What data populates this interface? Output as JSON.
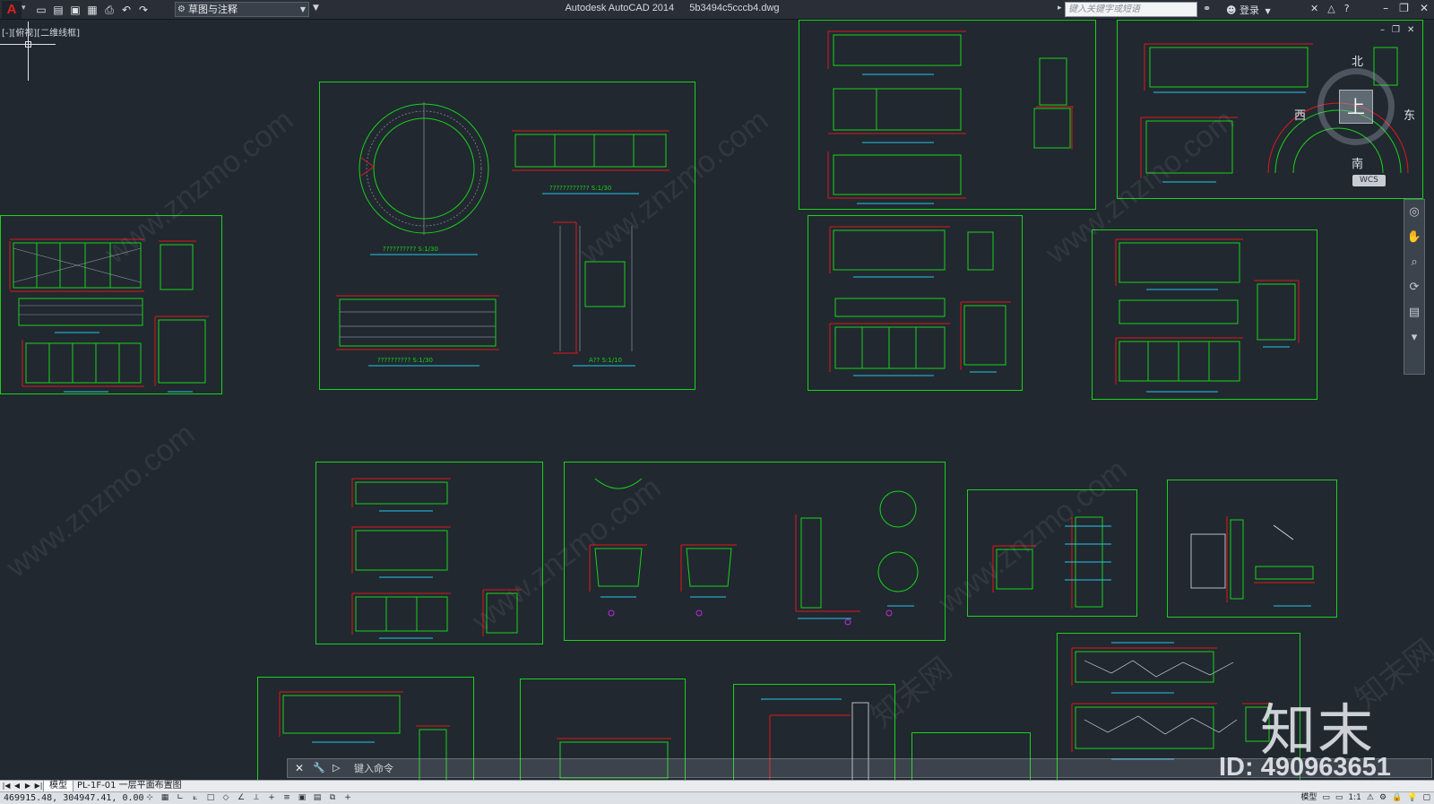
{
  "titlebar": {
    "app_logo": "A",
    "quick_access": [
      "new-icon",
      "open-icon",
      "save-icon",
      "save-as-icon",
      "print-icon",
      "undo-icon",
      "redo-icon"
    ],
    "workspace": "草图与注释",
    "title": "Autodesk AutoCAD 2014",
    "filename": "5b3494c5cccb4.dwg",
    "search_placeholder": "键入关键字或短语",
    "login": "登录"
  },
  "drawing": {
    "viewport_label": "[-][俯视][二维线框]",
    "background": "#212830",
    "sheet_border_color": "#19d219",
    "sheets": [
      {
        "id": "left-counter-elevations"
      },
      {
        "id": "round-reception-desk",
        "labels": [
          "?????????? S:1/30",
          "???????????? S:1/30",
          "?????????? S:1/30",
          "A?? S:1/10"
        ]
      },
      {
        "id": "top-middle-elevations"
      },
      {
        "id": "top-right-arc-desk"
      },
      {
        "id": "middle-counter-1"
      },
      {
        "id": "middle-counter-2"
      },
      {
        "id": "lower-counter-a"
      },
      {
        "id": "lower-basin-details"
      },
      {
        "id": "lower-section-1"
      },
      {
        "id": "lower-section-2"
      },
      {
        "id": "bottom-sheet-1"
      },
      {
        "id": "bottom-sheet-2"
      },
      {
        "id": "bottom-sheet-3"
      },
      {
        "id": "bottom-sheet-4"
      },
      {
        "id": "bottom-right-stone"
      }
    ],
    "watermark_text": "www.znzmo.com",
    "watermark_cn": "知末网",
    "brand_logo": "知末",
    "brand_id": "ID: 490963651"
  },
  "viewcube": {
    "face": "上",
    "north": "北",
    "south": "南",
    "east": "东",
    "west": "西",
    "wcs": "WCS"
  },
  "command_line": {
    "placeholder": "键入命令"
  },
  "tabs": {
    "model": "模型",
    "layout": "PL-1F-01 一层平面布置图"
  },
  "statusbar": {
    "coordinates": "469915.48, 304947.41, 0.00",
    "space": "模型",
    "scale": "1:1"
  }
}
